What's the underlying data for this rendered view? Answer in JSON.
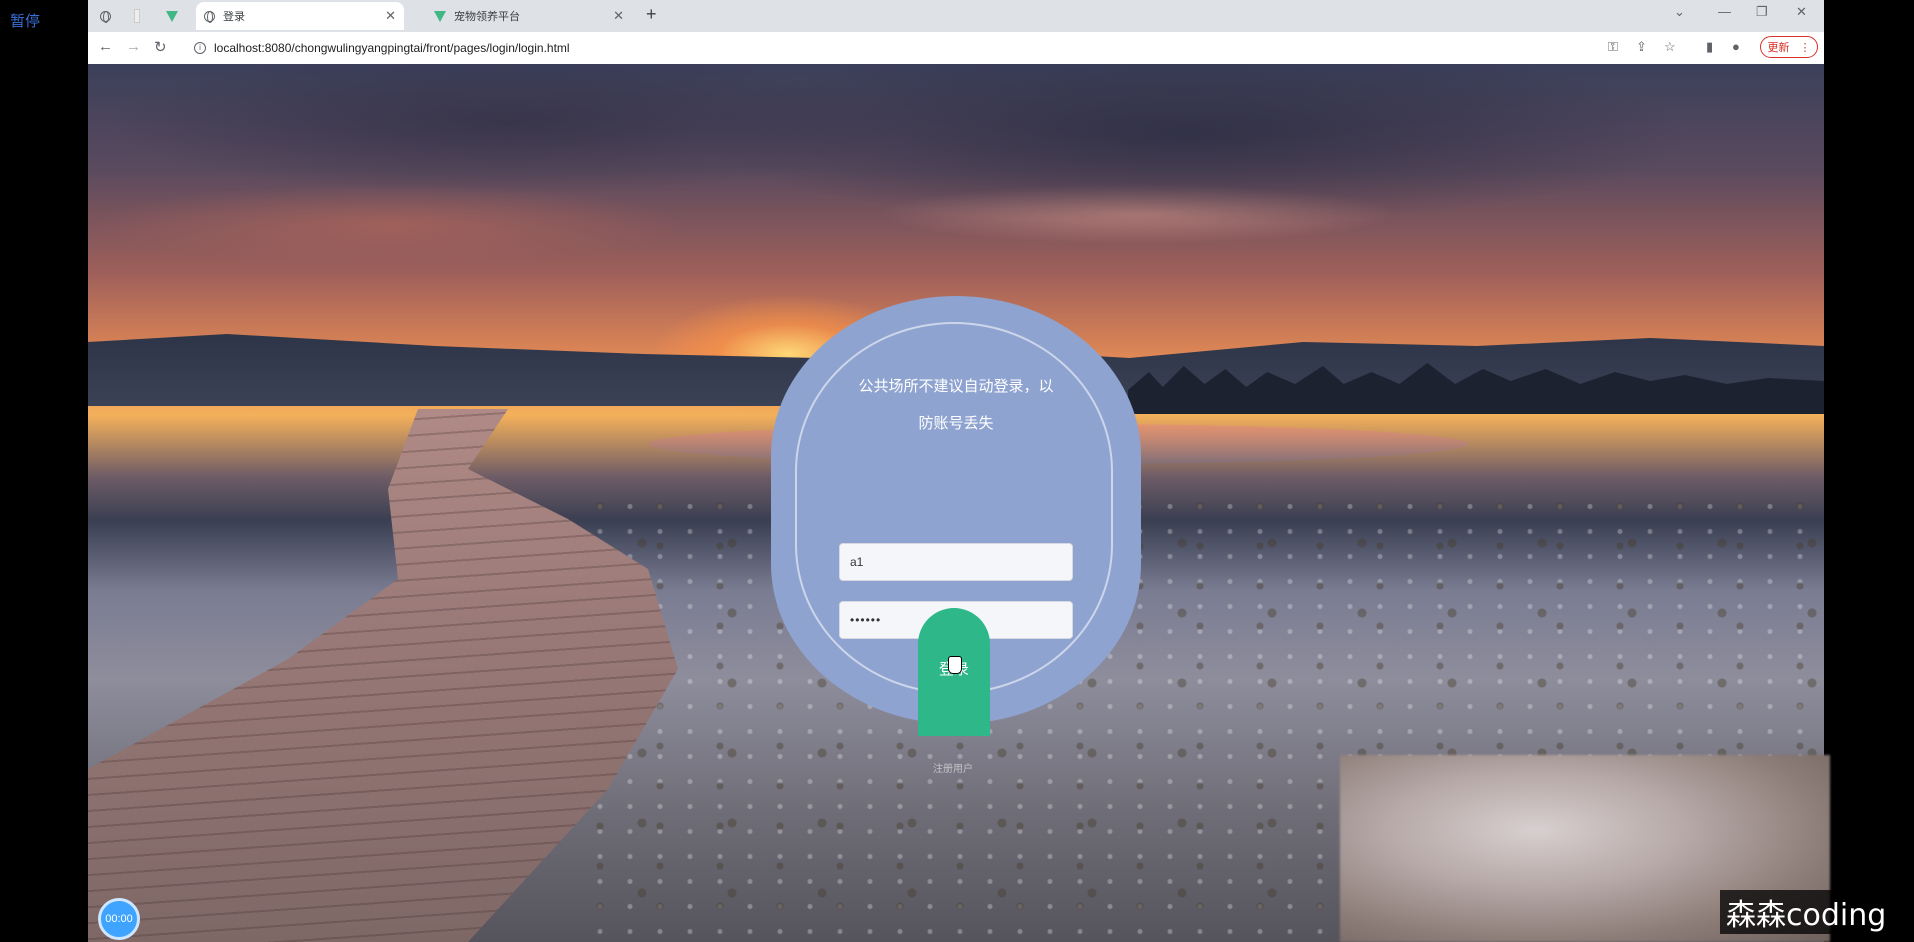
{
  "overlay": {
    "pause_label": "暂停",
    "timer": "00:00",
    "watermark": "森森coding"
  },
  "browser": {
    "tabs": [
      {
        "label": "",
        "icon": "globe-icon"
      },
      {
        "label": "",
        "icon": "blank-icon"
      },
      {
        "label": "",
        "icon": "vue-icon"
      },
      {
        "label": "登录",
        "icon": "globe-icon",
        "active": true
      },
      {
        "label": "宠物领养平台",
        "icon": "vue-icon"
      }
    ],
    "url": "localhost:8080/chongwulingyangpingtai/front/pages/login/login.html",
    "update_label": "更新"
  },
  "login": {
    "tip": "公共场所不建议自动登录，以防账号丢失",
    "username_value": "a1",
    "password_value": "••••••",
    "submit_label": "登录",
    "register_label": "注册用户"
  }
}
